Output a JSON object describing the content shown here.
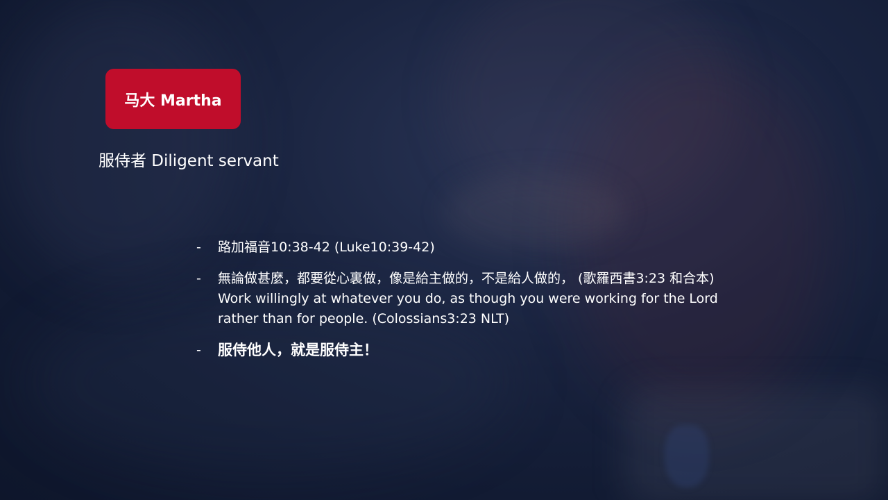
{
  "slide": {
    "title": "马大 Martha",
    "subtitle": "服侍者 Diligent servant",
    "accent_color": "#c00d2b",
    "bullet": "-",
    "points": [
      "路加福音10:38-42 (Luke10:39-42)",
      "無論做甚麼，都要從心裏做，像是給主做的，不是給人做的， (歌羅西書3:23 和合本) Work willingly at whatever you do, as though you were working for the  Lord rather than for people. (Colossians3:23 NLT)",
      "服侍他人，就是服侍主！"
    ]
  }
}
